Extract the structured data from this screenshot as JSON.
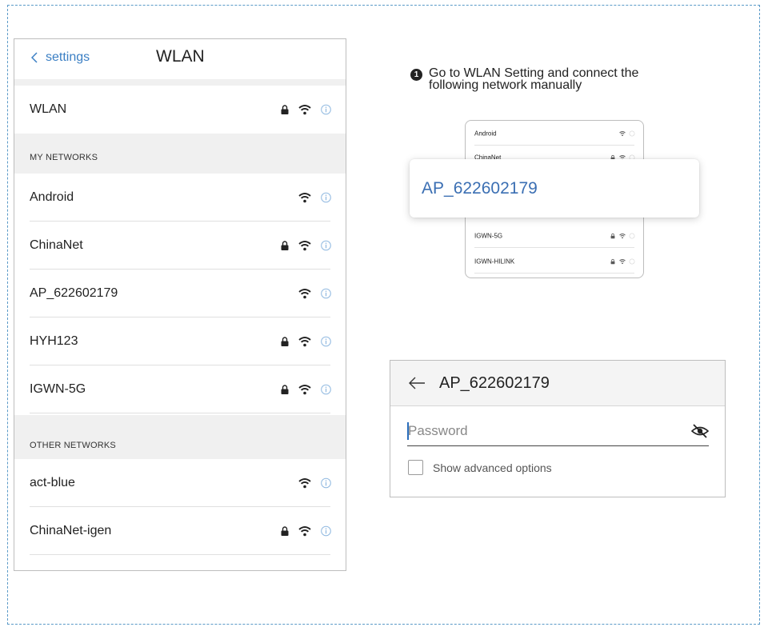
{
  "phone": {
    "back_label": "settings",
    "title": "WLAN",
    "wlan_row": {
      "label": "WLAN",
      "lock": true
    },
    "my_networks_header": "MY NETWORKS",
    "my_networks": [
      {
        "label": "Android",
        "lock": false
      },
      {
        "label": "ChinaNet",
        "lock": true
      },
      {
        "label": "AP_622602179",
        "lock": false
      },
      {
        "label": "HYH123",
        "lock": true
      },
      {
        "label": "IGWN-5G",
        "lock": true
      }
    ],
    "other_networks_header": "OTHER NETWORKS",
    "other_networks": [
      {
        "label": "act-blue",
        "lock": false
      },
      {
        "label": "ChinaNet-igen",
        "lock": true
      }
    ]
  },
  "step": {
    "number": "1",
    "text": "Go to WLAN Setting and connect the following network manually"
  },
  "mini_list": {
    "rows": [
      {
        "label": "Android",
        "lock": false
      },
      {
        "label": "ChinaNet",
        "lock": true
      },
      {
        "label": "IGWN-5G",
        "lock": true
      },
      {
        "label": "IGWN-HILINK",
        "lock": true
      }
    ],
    "highlight": "AP_622602179"
  },
  "dialog": {
    "title": "AP_622602179",
    "password_placeholder": "Password",
    "advanced_label": "Show advanced options",
    "advanced_checked": false
  },
  "colors": {
    "accent": "#3b7fc4",
    "highlight_text": "#3b6fb3",
    "frame_dash": "#5a9ac8",
    "section_bg": "#f0f0f0"
  },
  "icons": [
    "chevron-left-icon",
    "lock-icon",
    "wifi-icon",
    "info-icon",
    "back-arrow-icon",
    "eye-off-icon"
  ]
}
